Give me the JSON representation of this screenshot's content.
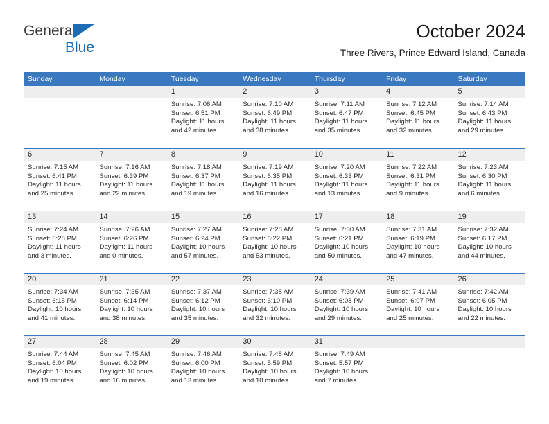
{
  "logo": {
    "name_top": "General",
    "name_bottom": "Blue",
    "triangle_icon": "triangle-icon",
    "accent_color": "#1d6cb5"
  },
  "header": {
    "title": "October 2024",
    "subtitle": "Three Rivers, Prince Edward Island, Canada"
  },
  "theme": {
    "header_blue": "#3a78bf",
    "band_gray": "#eeeeee",
    "text": "#2a2a2a"
  },
  "calendar": {
    "weekdays": [
      "Sunday",
      "Monday",
      "Tuesday",
      "Wednesday",
      "Thursday",
      "Friday",
      "Saturday"
    ],
    "weeks": [
      [
        {
          "day": "",
          "lines": []
        },
        {
          "day": "",
          "lines": []
        },
        {
          "day": "1",
          "lines": [
            "Sunrise: 7:08 AM",
            "Sunset: 6:51 PM",
            "Daylight: 11 hours",
            "and 42 minutes."
          ]
        },
        {
          "day": "2",
          "lines": [
            "Sunrise: 7:10 AM",
            "Sunset: 6:49 PM",
            "Daylight: 11 hours",
            "and 38 minutes."
          ]
        },
        {
          "day": "3",
          "lines": [
            "Sunrise: 7:11 AM",
            "Sunset: 6:47 PM",
            "Daylight: 11 hours",
            "and 35 minutes."
          ]
        },
        {
          "day": "4",
          "lines": [
            "Sunrise: 7:12 AM",
            "Sunset: 6:45 PM",
            "Daylight: 11 hours",
            "and 32 minutes."
          ]
        },
        {
          "day": "5",
          "lines": [
            "Sunrise: 7:14 AM",
            "Sunset: 6:43 PM",
            "Daylight: 11 hours",
            "and 29 minutes."
          ]
        }
      ],
      [
        {
          "day": "6",
          "lines": [
            "Sunrise: 7:15 AM",
            "Sunset: 6:41 PM",
            "Daylight: 11 hours",
            "and 25 minutes."
          ]
        },
        {
          "day": "7",
          "lines": [
            "Sunrise: 7:16 AM",
            "Sunset: 6:39 PM",
            "Daylight: 11 hours",
            "and 22 minutes."
          ]
        },
        {
          "day": "8",
          "lines": [
            "Sunrise: 7:18 AM",
            "Sunset: 6:37 PM",
            "Daylight: 11 hours",
            "and 19 minutes."
          ]
        },
        {
          "day": "9",
          "lines": [
            "Sunrise: 7:19 AM",
            "Sunset: 6:35 PM",
            "Daylight: 11 hours",
            "and 16 minutes."
          ]
        },
        {
          "day": "10",
          "lines": [
            "Sunrise: 7:20 AM",
            "Sunset: 6:33 PM",
            "Daylight: 11 hours",
            "and 13 minutes."
          ]
        },
        {
          "day": "11",
          "lines": [
            "Sunrise: 7:22 AM",
            "Sunset: 6:31 PM",
            "Daylight: 11 hours",
            "and 9 minutes."
          ]
        },
        {
          "day": "12",
          "lines": [
            "Sunrise: 7:23 AM",
            "Sunset: 6:30 PM",
            "Daylight: 11 hours",
            "and 6 minutes."
          ]
        }
      ],
      [
        {
          "day": "13",
          "lines": [
            "Sunrise: 7:24 AM",
            "Sunset: 6:28 PM",
            "Daylight: 11 hours",
            "and 3 minutes."
          ]
        },
        {
          "day": "14",
          "lines": [
            "Sunrise: 7:26 AM",
            "Sunset: 6:26 PM",
            "Daylight: 11 hours",
            "and 0 minutes."
          ]
        },
        {
          "day": "15",
          "lines": [
            "Sunrise: 7:27 AM",
            "Sunset: 6:24 PM",
            "Daylight: 10 hours",
            "and 57 minutes."
          ]
        },
        {
          "day": "16",
          "lines": [
            "Sunrise: 7:28 AM",
            "Sunset: 6:22 PM",
            "Daylight: 10 hours",
            "and 53 minutes."
          ]
        },
        {
          "day": "17",
          "lines": [
            "Sunrise: 7:30 AM",
            "Sunset: 6:21 PM",
            "Daylight: 10 hours",
            "and 50 minutes."
          ]
        },
        {
          "day": "18",
          "lines": [
            "Sunrise: 7:31 AM",
            "Sunset: 6:19 PM",
            "Daylight: 10 hours",
            "and 47 minutes."
          ]
        },
        {
          "day": "19",
          "lines": [
            "Sunrise: 7:32 AM",
            "Sunset: 6:17 PM",
            "Daylight: 10 hours",
            "and 44 minutes."
          ]
        }
      ],
      [
        {
          "day": "20",
          "lines": [
            "Sunrise: 7:34 AM",
            "Sunset: 6:15 PM",
            "Daylight: 10 hours",
            "and 41 minutes."
          ]
        },
        {
          "day": "21",
          "lines": [
            "Sunrise: 7:35 AM",
            "Sunset: 6:14 PM",
            "Daylight: 10 hours",
            "and 38 minutes."
          ]
        },
        {
          "day": "22",
          "lines": [
            "Sunrise: 7:37 AM",
            "Sunset: 6:12 PM",
            "Daylight: 10 hours",
            "and 35 minutes."
          ]
        },
        {
          "day": "23",
          "lines": [
            "Sunrise: 7:38 AM",
            "Sunset: 6:10 PM",
            "Daylight: 10 hours",
            "and 32 minutes."
          ]
        },
        {
          "day": "24",
          "lines": [
            "Sunrise: 7:39 AM",
            "Sunset: 6:08 PM",
            "Daylight: 10 hours",
            "and 29 minutes."
          ]
        },
        {
          "day": "25",
          "lines": [
            "Sunrise: 7:41 AM",
            "Sunset: 6:07 PM",
            "Daylight: 10 hours",
            "and 25 minutes."
          ]
        },
        {
          "day": "26",
          "lines": [
            "Sunrise: 7:42 AM",
            "Sunset: 6:05 PM",
            "Daylight: 10 hours",
            "and 22 minutes."
          ]
        }
      ],
      [
        {
          "day": "27",
          "lines": [
            "Sunrise: 7:44 AM",
            "Sunset: 6:04 PM",
            "Daylight: 10 hours",
            "and 19 minutes."
          ]
        },
        {
          "day": "28",
          "lines": [
            "Sunrise: 7:45 AM",
            "Sunset: 6:02 PM",
            "Daylight: 10 hours",
            "and 16 minutes."
          ]
        },
        {
          "day": "29",
          "lines": [
            "Sunrise: 7:46 AM",
            "Sunset: 6:00 PM",
            "Daylight: 10 hours",
            "and 13 minutes."
          ]
        },
        {
          "day": "30",
          "lines": [
            "Sunrise: 7:48 AM",
            "Sunset: 5:59 PM",
            "Daylight: 10 hours",
            "and 10 minutes."
          ]
        },
        {
          "day": "31",
          "lines": [
            "Sunrise: 7:49 AM",
            "Sunset: 5:57 PM",
            "Daylight: 10 hours",
            "and 7 minutes."
          ]
        },
        {
          "day": "",
          "lines": []
        },
        {
          "day": "",
          "lines": []
        }
      ]
    ]
  }
}
